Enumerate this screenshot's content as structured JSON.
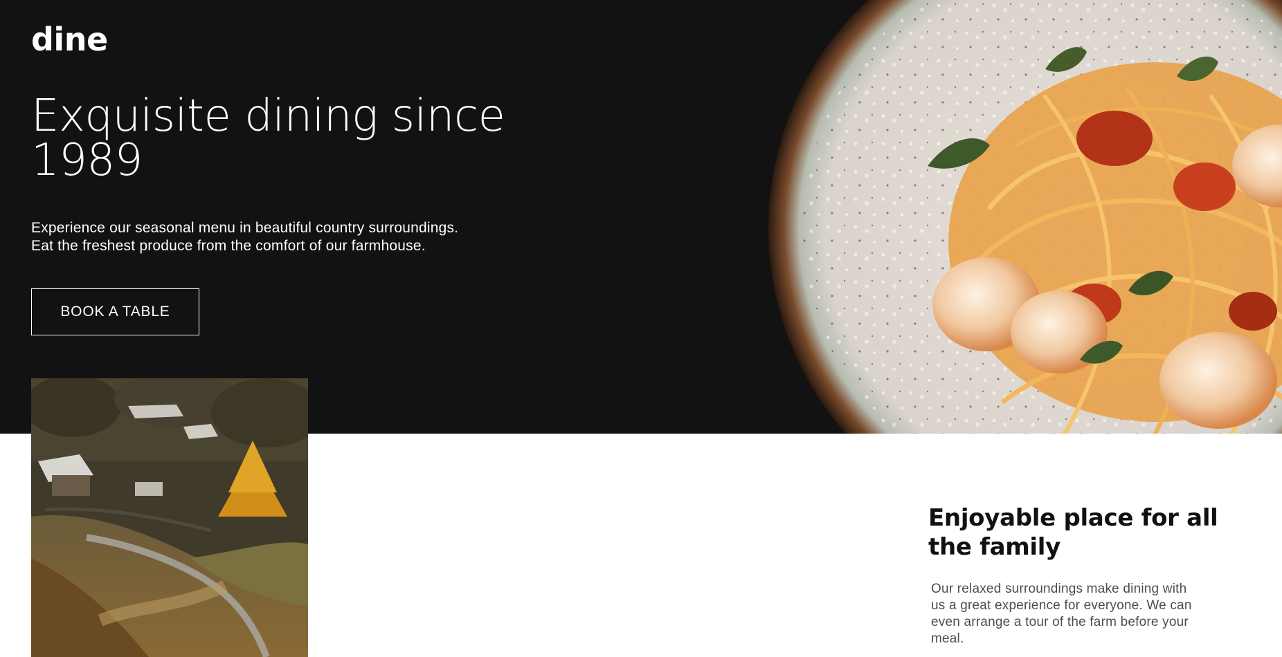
{
  "brand": {
    "logo": "dine"
  },
  "hero": {
    "title": "Exquisite dining since 1989",
    "description": "Experience our seasonal menu in beautiful country surroundings. Eat the freshest produce from the comfort of our farmhouse.",
    "cta_label": "BOOK A TABLE"
  },
  "feature": {
    "title": "Enjoyable place for all the family",
    "description": "Our relaxed surroundings make dining with us a great experience for everyone. We can even arrange a tour of the farm before your meal."
  },
  "images": {
    "hero_image": "pasta-with-shrimp-plate",
    "feature_image": "countryside-farm-village"
  },
  "colors": {
    "hero_background": "#121212",
    "page_background": "#ffffff",
    "text_light": "#ffffff",
    "text_dark": "#111111",
    "text_muted": "#4d4d4d"
  }
}
